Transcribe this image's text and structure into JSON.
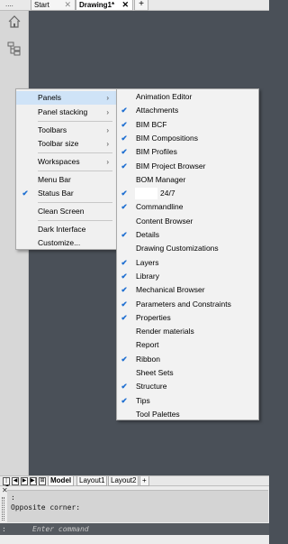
{
  "tabbar": {
    "dots": "....",
    "tabs": [
      {
        "label": "Start",
        "close": "✕"
      },
      {
        "label": "Drawing1*",
        "close": "✕"
      }
    ],
    "add": "+"
  },
  "panels_menu": {
    "items": [
      {
        "label": "Panels",
        "arrow": "›",
        "checked": false,
        "highlighted": true
      },
      {
        "label": "Panel stacking",
        "arrow": "›",
        "checked": false
      },
      {
        "label": "Toolbars",
        "arrow": "›",
        "checked": false
      },
      {
        "label": "Toolbar size",
        "arrow": "›",
        "checked": false
      },
      {
        "label": "Workspaces",
        "arrow": "›",
        "checked": false
      },
      {
        "label": "Menu Bar",
        "checked": false
      },
      {
        "label": "Status Bar",
        "checked": true
      },
      {
        "label": "Clean Screen",
        "checked": false
      },
      {
        "label": "Dark Interface",
        "checked": false
      },
      {
        "label": "Customize...",
        "checked": false
      }
    ]
  },
  "panels_submenu": {
    "items": [
      {
        "label": "Animation Editor",
        "checked": false
      },
      {
        "label": "Attachments",
        "checked": true
      },
      {
        "label": "BIM BCF",
        "checked": true
      },
      {
        "label": "BIM Compositions",
        "checked": true
      },
      {
        "label": "BIM Profiles",
        "checked": true
      },
      {
        "label": "BIM Project Browser",
        "checked": true
      },
      {
        "label": "BOM Manager",
        "checked": false
      },
      {
        "label": "24/7",
        "checked": true
      },
      {
        "label": "Commandline",
        "checked": true
      },
      {
        "label": "Content Browser",
        "checked": false
      },
      {
        "label": "Details",
        "checked": true
      },
      {
        "label": "Drawing Customizations",
        "checked": false
      },
      {
        "label": "Layers",
        "checked": true
      },
      {
        "label": "Library",
        "checked": true
      },
      {
        "label": "Mechanical Browser",
        "checked": true
      },
      {
        "label": "Parameters and Constraints",
        "checked": true
      },
      {
        "label": "Properties",
        "checked": true
      },
      {
        "label": "Render materials",
        "checked": false
      },
      {
        "label": "Report",
        "checked": false
      },
      {
        "label": "Ribbon",
        "checked": true
      },
      {
        "label": "Sheet Sets",
        "checked": false
      },
      {
        "label": "Structure",
        "checked": true
      },
      {
        "label": "Tips",
        "checked": true
      },
      {
        "label": "Tool Palettes",
        "checked": false
      }
    ]
  },
  "check_glyph": "✔",
  "layout_bar": {
    "nav": [
      "|◀",
      "◀",
      "▶",
      "▶|",
      "⊞"
    ],
    "tabs": [
      {
        "label": "Model",
        "active": true
      },
      {
        "label": "Layout1",
        "active": false
      },
      {
        "label": "Layout2",
        "active": false
      }
    ],
    "add": "+"
  },
  "command": {
    "close": "✕",
    "history": [
      ":",
      "Opposite corner:"
    ],
    "prefix": ":",
    "placeholder": "Enter command"
  }
}
